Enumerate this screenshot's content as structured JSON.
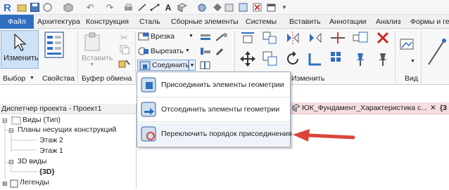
{
  "tabs": [
    "Файл",
    "Архитектура",
    "Конструкция",
    "Сталь",
    "Сборные элементы",
    "Системы",
    "Вставить",
    "Аннотации",
    "Анализ",
    "Формы и ге"
  ],
  "ribbon": {
    "modify_label": "Изменить",
    "insert_label": "Вставить",
    "cut_label": "Врезка",
    "cutout_label": "Вырезать",
    "join_label": "Соединить",
    "panels": {
      "select": "Выбор",
      "properties": "Свойства",
      "clipboard": "Буфер обмена",
      "modify": "Изменить",
      "view": "Вид"
    }
  },
  "dropdown": {
    "items": [
      "Присоединить элементы геометрии",
      "Отсоединить элементы геометрии",
      "Переключить порядок присоединения"
    ]
  },
  "project_browser": {
    "title": "Диспетчер проекта - Проект1",
    "tree": [
      "Виды (Тип)",
      "Планы несущих конструкций",
      "Этаж 2",
      "Этаж 1",
      "3D виды",
      "{3D}",
      "Легенды"
    ]
  },
  "view_tab": {
    "title": "ЮК_Фундамент_Характеристика с...",
    "extra": "{3"
  },
  "colors": {
    "accent": "#2f6fbf",
    "arrow": "#d9453b",
    "active_fill": "#cde1f7"
  }
}
